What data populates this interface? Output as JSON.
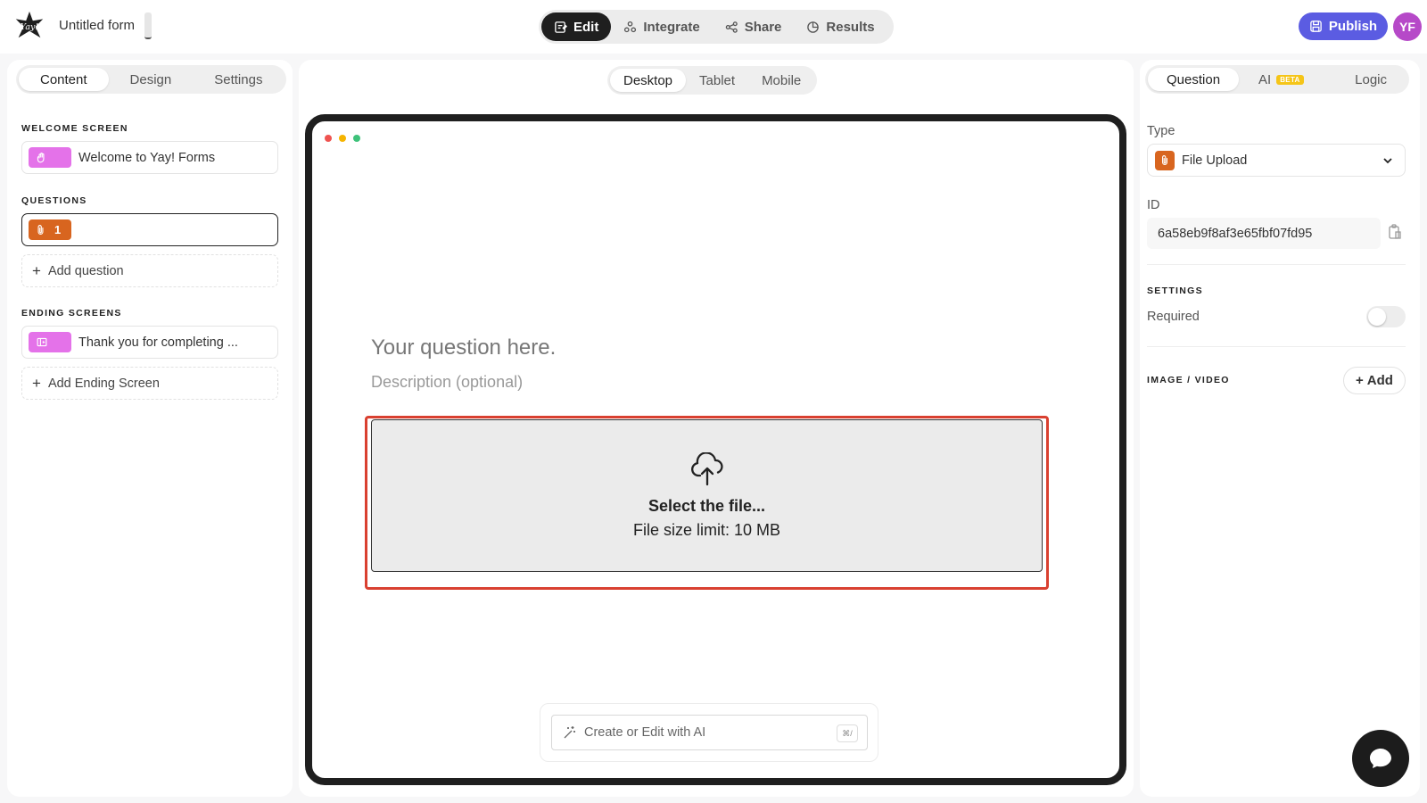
{
  "header": {
    "form_title": "Untitled form",
    "nav": [
      {
        "label": "Edit",
        "icon": "edit-icon"
      },
      {
        "label": "Integrate",
        "icon": "integrate-icon"
      },
      {
        "label": "Share",
        "icon": "share-icon"
      },
      {
        "label": "Results",
        "icon": "results-icon"
      }
    ],
    "active_nav": "Edit",
    "publish_label": "Publish",
    "avatar_initials": "YF"
  },
  "left_panel": {
    "tabs": [
      "Content",
      "Design",
      "Settings"
    ],
    "active_tab": "Content",
    "welcome_label": "WELCOME SCREEN",
    "welcome_item": "Welcome to Yay! Forms",
    "questions_label": "QUESTIONS",
    "question_number": "1",
    "add_question": "Add question",
    "ending_label": "ENDING SCREENS",
    "ending_item": "Thank you for completing ...",
    "add_ending": "Add Ending Screen"
  },
  "center_panel": {
    "device_tabs": [
      "Desktop",
      "Tablet",
      "Mobile"
    ],
    "active_device": "Desktop",
    "question_placeholder": "Your question here.",
    "description_placeholder": "Description (optional)",
    "upload_title": "Select the file...",
    "upload_limit": "File size limit: 10 MB",
    "ai_placeholder": "Create or Edit with AI",
    "ai_shortcut": "⌘/"
  },
  "right_panel": {
    "tabs": [
      "Question",
      "AI",
      "Logic"
    ],
    "active_tab": "Question",
    "ai_badge": "BETA",
    "type_label": "Type",
    "type_value": "File Upload",
    "id_label": "ID",
    "id_value": "6a58eb9f8af3e65fbf07fd95",
    "settings_label": "SETTINGS",
    "required_label": "Required",
    "required_on": false,
    "media_label": "IMAGE / VIDEO",
    "add_label": "Add"
  },
  "colors": {
    "publish": "#5b5ce2",
    "avatar": "#b649c8",
    "welcome_chip": "#e472e9",
    "question_chip": "#d8651f",
    "highlight": "#d94030",
    "dot_red": "#ef5350",
    "dot_yellow": "#f5b400",
    "dot_green": "#3ec27a"
  }
}
